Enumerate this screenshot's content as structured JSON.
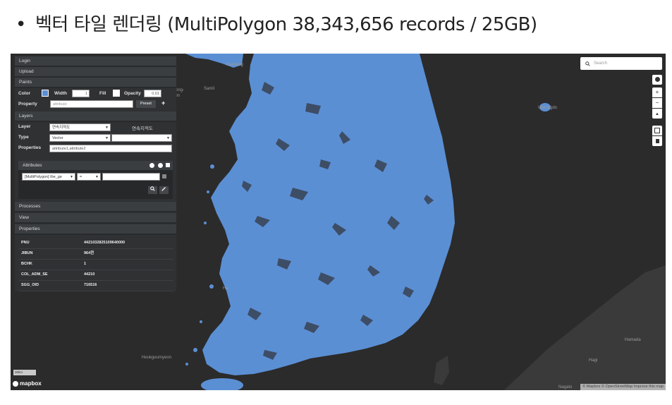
{
  "slide": {
    "bullet": "•",
    "title": "벡터 타일 렌더링 (MultiPolygon 38,343,656 records / 25GB)"
  },
  "map": {
    "land_color": "#5b8fd4",
    "background_color": "#2b2b2b",
    "places": [
      {
        "id": "kaesong",
        "label": "Kaesong"
      },
      {
        "id": "ulleungdo",
        "label": "Ulleungdo"
      },
      {
        "id": "heukgeumyeon",
        "label": "Heukgeumyeon"
      },
      {
        "id": "hamada",
        "label": "Hamada"
      },
      {
        "id": "hagi",
        "label": "Hagi"
      },
      {
        "id": "nagato",
        "label": "Nagato"
      },
      {
        "id": "ha",
        "label": "Ha"
      },
      {
        "id": "ongjin",
        "label": "ong-"
      },
      {
        "id": "samil",
        "label": "Samil"
      },
      {
        "id": "jin",
        "label": "jin"
      }
    ],
    "search_placeholder": "Search",
    "scale_label": "30km",
    "logo_text": "mapbox",
    "attribution": "© Mapbox © OpenStreetMap Improve this map"
  },
  "panel": {
    "login": "Login",
    "upload": "Upload",
    "paints": {
      "header": "Paints",
      "color_label": "Color",
      "color_value": "#5b8fd4",
      "width_label": "Width",
      "width_value": "1",
      "fill_label": "Fill",
      "opacity_label": "Opacity",
      "opacity_value": "0.01",
      "property_label": "Property",
      "property_value": "attribute",
      "preset_label": "Preset",
      "add_label": "+"
    },
    "layers": {
      "header": "Layers",
      "layer_label": "Layer",
      "layer_value": "연속지적도",
      "layer_name": "연속지적도",
      "type_label": "Type",
      "type_value": "Vector",
      "properties_label": "Properties",
      "properties_value": "attribute1,attribute2",
      "attributes_label": "Attributes",
      "attr_field": "[MultiPolygon] the_ge",
      "attr_op": "="
    },
    "processes": "Processes",
    "view": "View",
    "properties": {
      "header": "Properties",
      "rows": [
        {
          "key": "PNU",
          "value": "4421032825109640000"
        },
        {
          "key": "JIBUN",
          "value": "964전"
        },
        {
          "key": "BCHK",
          "value": "1"
        },
        {
          "key": "COL_ADM_SE",
          "value": "44210"
        },
        {
          "key": "SGG_OID",
          "value": "716516"
        }
      ]
    }
  }
}
